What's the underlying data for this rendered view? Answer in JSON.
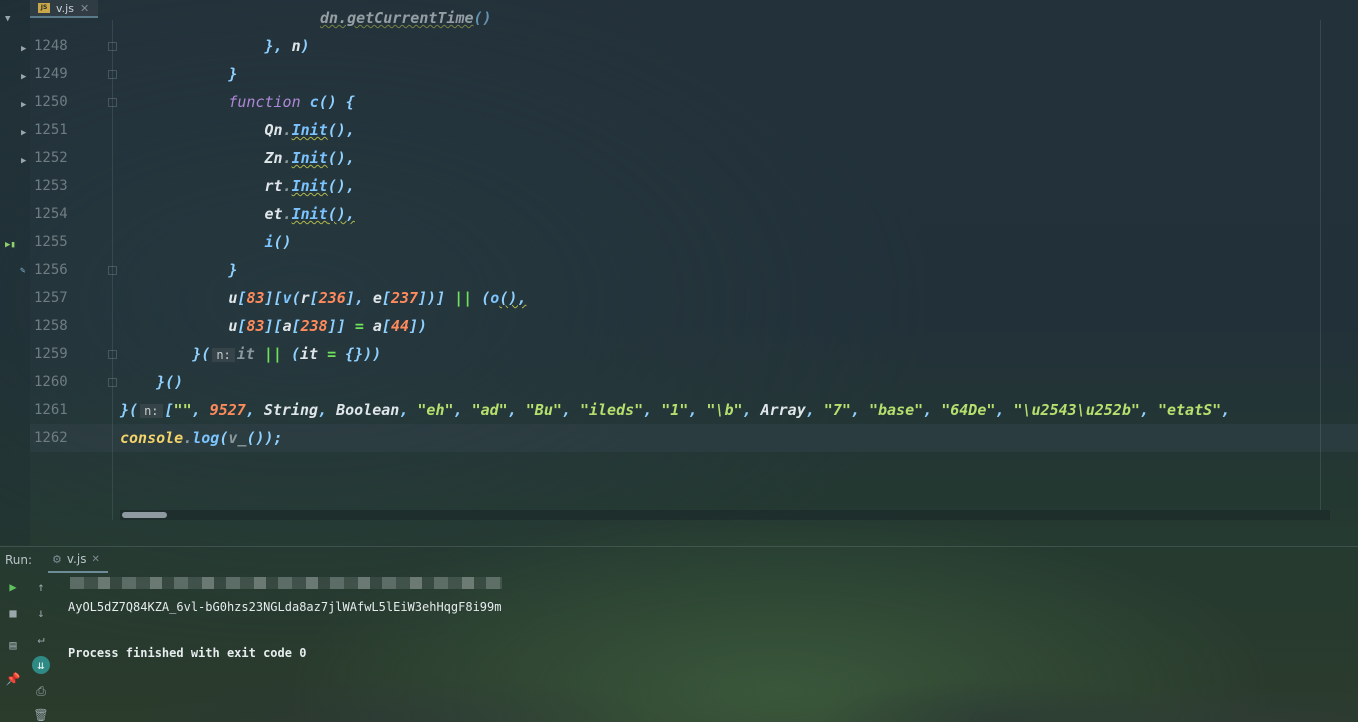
{
  "editor": {
    "tab": {
      "file_name": "v.js",
      "icon": "js-file-icon"
    },
    "line_numbers": [
      "1248",
      "1249",
      "1250",
      "1251",
      "1252",
      "1253",
      "1254",
      "1255",
      "1256",
      "1257",
      "1258",
      "1259",
      "1260",
      "1261",
      "1262"
    ],
    "current_line": "1262",
    "parameter_hint_n": "n:"
  },
  "run": {
    "label": "Run:",
    "tab_name": "v.js",
    "output_line": "AyOL5dZ7Q84KZA_6vl-bG0hzs23NGLda8az7jlWAfwL5lEiW3ehHqgF8i99m",
    "exit_message": "Process finished with exit code 0"
  },
  "colors": {
    "keyword": "#b088d8",
    "function_call": "#7cc4ff",
    "number": "#ff8a5c",
    "string": "#b6e06e",
    "operator": "#6ee35a",
    "console": "#f3d36a"
  }
}
